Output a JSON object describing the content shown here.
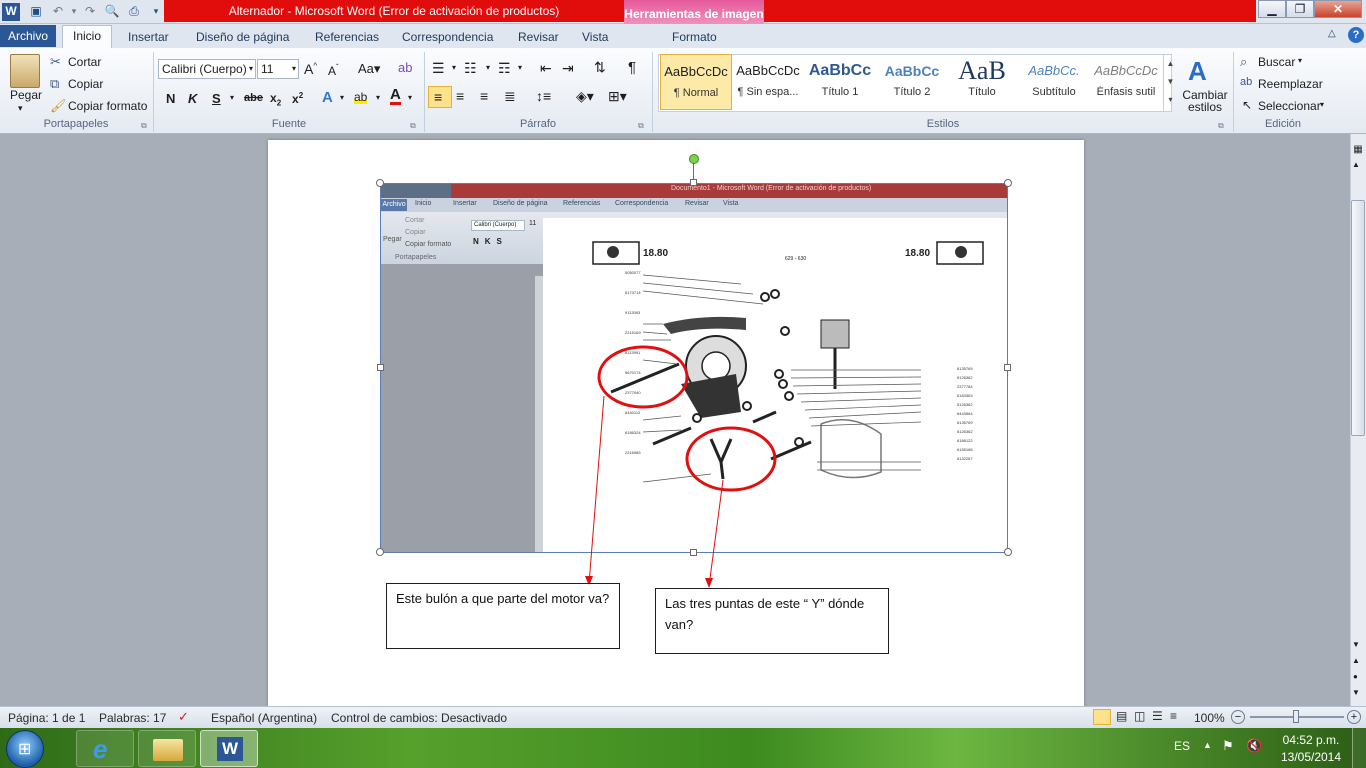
{
  "window": {
    "title": "Alternador  -  Microsoft Word (Error de activación de productos)",
    "context_tab": "Herramientas de imagen"
  },
  "tabs": {
    "archivo": "Archivo",
    "items": [
      "Inicio",
      "Insertar",
      "Diseño de página",
      "Referencias",
      "Correspondencia",
      "Revisar",
      "Vista"
    ],
    "formato": "Formato"
  },
  "ribbon": {
    "portapapeles": {
      "label": "Portapapeles",
      "pegar": "Pegar",
      "cortar": "Cortar",
      "copiar": "Copiar",
      "copiar_formato": "Copiar formato"
    },
    "fuente": {
      "label": "Fuente",
      "font_name": "Calibri (Cuerpo)",
      "font_size": "11"
    },
    "parrafo": {
      "label": "Párrafo"
    },
    "estilos": {
      "label": "Estilos",
      "items": [
        {
          "sample": "AaBbCcDc",
          "name": "¶ Normal"
        },
        {
          "sample": "AaBbCcDc",
          "name": "¶ Sin espa..."
        },
        {
          "sample": "AaBbCc",
          "name": "Título 1"
        },
        {
          "sample": "AaBbCc",
          "name": "Título 2"
        },
        {
          "sample": "AaB",
          "name": "Título"
        },
        {
          "sample": "AaBbCc.",
          "name": "Subtítulo"
        },
        {
          "sample": "AaBbCcDc",
          "name": "Énfasis sutil"
        }
      ],
      "cambiar_estilos": "Cambiar estilos"
    },
    "edicion": {
      "label": "Edición",
      "buscar": "Buscar",
      "reemplazar": "Reemplazar",
      "seleccionar": "Seleccionar"
    }
  },
  "embedded_screenshot": {
    "title": "Documento1  -  Microsoft Word (Error de activación de productos)",
    "tabs": [
      "Archivo",
      "Inicio",
      "Insertar",
      "Diseño de página",
      "Referencias",
      "Correspondencia",
      "Revisar",
      "Vista"
    ],
    "cortar": "Cortar",
    "copiar": "Copiar",
    "copiar_formato": "Copiar formato",
    "pegar": "Pegar",
    "portapapeles": "Portapapeles",
    "font": "Calibri (Cuerpo)",
    "size": "11",
    "diagram_page_left": "18.80",
    "diagram_page_right": "18.80",
    "diagram_code": "629 - 630",
    "part_numbers_left": [
      "5050077",
      "6173714",
      "9113093",
      "2215169",
      "6113991",
      "9670174",
      "2377940",
      "6440112",
      "6186324",
      "2216985"
    ],
    "part_numbers_right": [
      "6135769",
      "5126362",
      "2377784",
      "6183363",
      "5126362",
      "6443564",
      "6135769",
      "5126362",
      "6186122",
      "6155166",
      "6132267"
    ]
  },
  "callouts": {
    "left": "Este bulón a que parte del motor va?",
    "right": "Las tres puntas de este “ Y” dónde van?"
  },
  "status": {
    "page": "Página: 1 de 1",
    "words": "Palabras: 17",
    "language": "Español (Argentina)",
    "track_changes": "Control de cambios: Desactivado",
    "zoom": "100%"
  },
  "taskbar": {
    "lang": "ES",
    "time": "04:52 p.m.",
    "date": "13/05/2014"
  },
  "colors": {
    "title_red": "#e10d0d",
    "archivo_blue": "#2b5797",
    "annotation_red": "#e01010"
  }
}
